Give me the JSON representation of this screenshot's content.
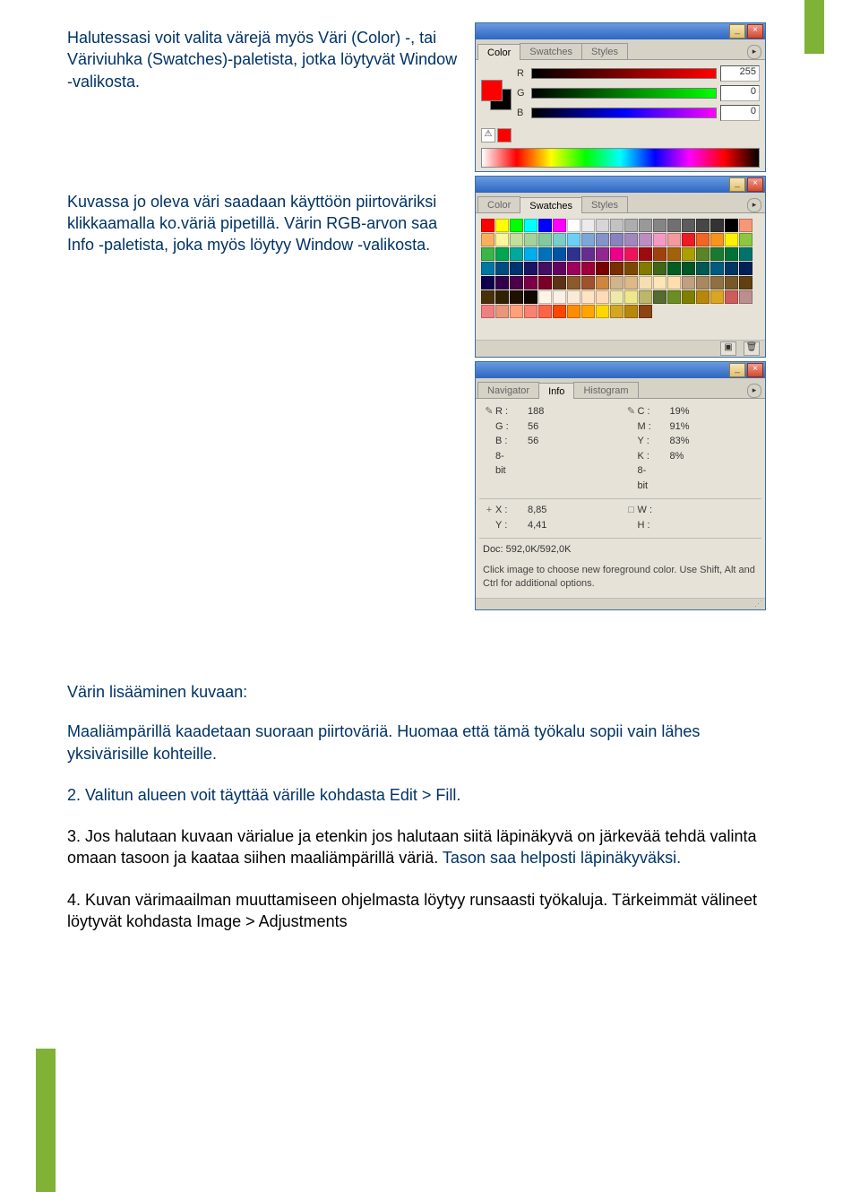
{
  "text": {
    "p1": "Halutessasi voit valita värejä myös Väri (Color) -, tai Väriviuhka (Swatches)-paletista, jotka löytyvät Window -valikosta.",
    "p2": "Kuvassa jo oleva väri saadaan käyttöön piirtoväriksi klikkaamalla ko.väriä pipetillä. Värin RGB-arvon saa Info -paletista, joka myös löytyy Window -valikosta.",
    "hdr": "Värin lisääminen kuvaan:",
    "b1": "Maaliämpärillä kaadetaan suoraan piirtoväriä. Huomaa että tämä työkalu sopii vain lähes yksivärisille kohteille.",
    "b2": "2. Valitun alueen voit täyttää värille kohdasta Edit > Fill.",
    "b3a": "3. Jos halutaan kuvaan värialue ja etenkin jos halutaan siitä läpinäkyvä on järkevää tehdä valinta omaan tasoon ja kaataa siihen maaliämpärillä väriä.",
    "b3b": "Tason saa helposti läpinäkyväksi.",
    "b4": "4. Kuvan värimaailman muuttamiseen ohjelmasta löytyy runsaasti työkaluja. Tärkeimmät välineet löytyvät kohdasta Image > Adjustments"
  },
  "color_panel": {
    "tabs": [
      "Color",
      "Swatches",
      "Styles"
    ],
    "active_tab": "Color",
    "channels": [
      {
        "label": "R",
        "value": "255"
      },
      {
        "label": "G",
        "value": "0"
      },
      {
        "label": "B",
        "value": "0"
      }
    ]
  },
  "swatches_panel": {
    "tabs": [
      "Color",
      "Swatches",
      "Styles"
    ],
    "active_tab": "Swatches"
  },
  "info_panel": {
    "tabs": [
      "Navigator",
      "Info",
      "Histogram"
    ],
    "active_tab": "Info",
    "left_col": [
      {
        "icon": "✎",
        "label": "R :",
        "value": "188"
      },
      {
        "icon": "",
        "label": "G :",
        "value": "56"
      },
      {
        "icon": "",
        "label": "B :",
        "value": "56"
      },
      {
        "icon": "",
        "label": "8-bit",
        "value": ""
      }
    ],
    "right_col": [
      {
        "icon": "✎",
        "label": "C :",
        "value": "19%"
      },
      {
        "icon": "",
        "label": "M :",
        "value": "91%"
      },
      {
        "icon": "",
        "label": "Y :",
        "value": "83%"
      },
      {
        "icon": "",
        "label": "K :",
        "value": "8%"
      },
      {
        "icon": "",
        "label": "8-bit",
        "value": ""
      }
    ],
    "xy": [
      {
        "icon": "+",
        "label": "X :",
        "value": "8,85"
      },
      {
        "icon": "",
        "label": "Y :",
        "value": "4,41"
      }
    ],
    "wh": [
      {
        "icon": "□",
        "label": "W :",
        "value": ""
      },
      {
        "icon": "",
        "label": "H :",
        "value": ""
      }
    ],
    "doc": "Doc: 592,0K/592,0K",
    "hint": "Click image to choose new foreground color. Use Shift, Alt and Ctrl for additional options."
  },
  "swatch_colors": [
    "#ff0000",
    "#ffff00",
    "#00ff00",
    "#00ffff",
    "#0000ff",
    "#ff00ff",
    "#ffffff",
    "#ebebeb",
    "#d6d6d6",
    "#c2c2c2",
    "#adadad",
    "#999999",
    "#858585",
    "#707070",
    "#5c5c5c",
    "#474747",
    "#333333",
    "#000000",
    "#f7977a",
    "#fbaf5d",
    "#fff79a",
    "#c4df9b",
    "#a2d39c",
    "#82ca9d",
    "#7bcdc8",
    "#6ecff6",
    "#7ea7d8",
    "#8493ca",
    "#8882be",
    "#a187be",
    "#bc8dbf",
    "#f49ac2",
    "#f6989d",
    "#ed1c24",
    "#f26522",
    "#f7941d",
    "#fff200",
    "#8dc73f",
    "#39b54a",
    "#00a651",
    "#00a99d",
    "#00aeef",
    "#0072bc",
    "#0054a6",
    "#2e3192",
    "#662d91",
    "#92278f",
    "#ec008c",
    "#ed145b",
    "#9e0b0f",
    "#a0410d",
    "#a36209",
    "#aba000",
    "#598527",
    "#1a7b30",
    "#007236",
    "#00746b",
    "#0076a3",
    "#004b80",
    "#003471",
    "#1b1464",
    "#440e62",
    "#630460",
    "#9e005d",
    "#9e0039",
    "#790000",
    "#7b2e00",
    "#7d4900",
    "#827b00",
    "#406618",
    "#005e20",
    "#005826",
    "#005952",
    "#005b7f",
    "#003663",
    "#002157",
    "#0d004c",
    "#32004b",
    "#4b0049",
    "#7b0046",
    "#7a0026",
    "#5c3317",
    "#8b5a2b",
    "#a0522d",
    "#cd853f",
    "#d2b48c",
    "#deb887",
    "#f5deb3",
    "#ffe4b5",
    "#ffdead",
    "#c0a080",
    "#a88860",
    "#907040",
    "#785828",
    "#604010",
    "#483008",
    "#302004",
    "#201000",
    "#100800",
    "#fdf5e6",
    "#faf0e6",
    "#faebd7",
    "#ffe4c4",
    "#ffdab9",
    "#eee8aa",
    "#f0e68c",
    "#bdb76b",
    "#556b2f",
    "#6b8e23",
    "#808000",
    "#b8860b",
    "#daa520",
    "#cd5c5c",
    "#bc8f8f",
    "#f08080",
    "#e9967a",
    "#ffa07a",
    "#fa8072",
    "#ff6347",
    "#ff4500",
    "#ff8c00",
    "#ffa500",
    "#ffd700",
    "#d3a625",
    "#b8860b",
    "#8b4513"
  ]
}
